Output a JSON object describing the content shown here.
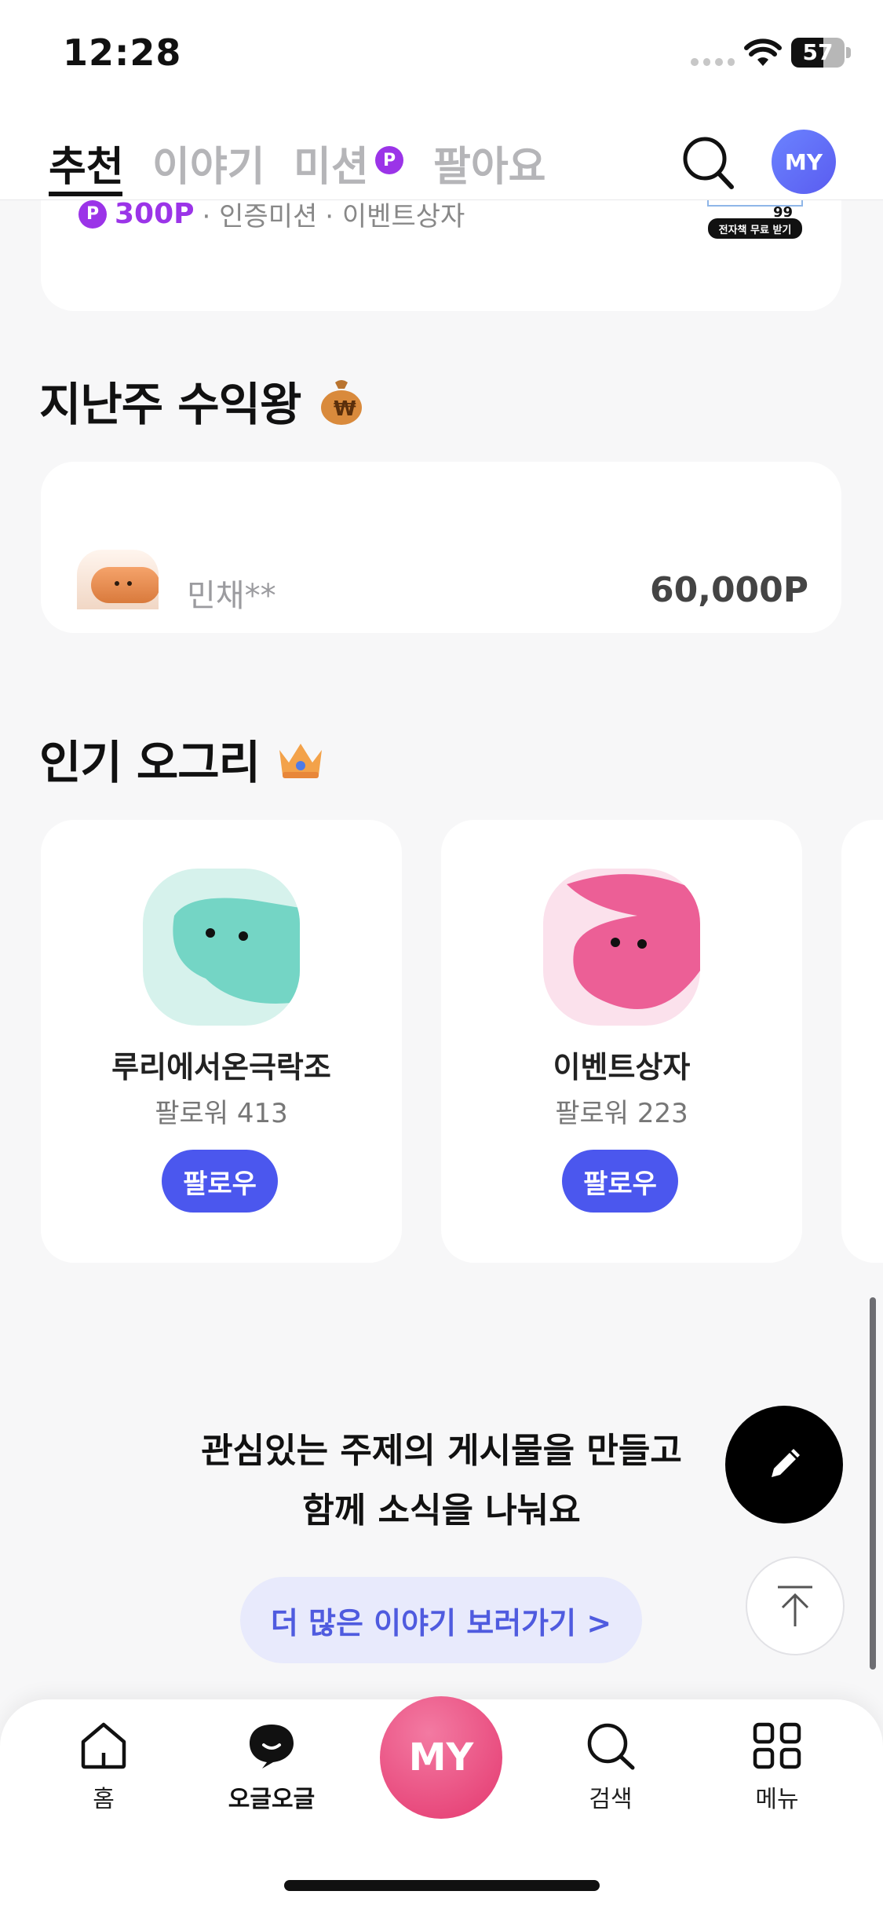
{
  "status_bar": {
    "time": "12:28",
    "battery": "57"
  },
  "top_nav": {
    "tabs": [
      {
        "label": "추천",
        "active": true
      },
      {
        "label": "이야기",
        "active": false
      },
      {
        "label": "미션",
        "active": false,
        "badge": "P"
      },
      {
        "label": "팔아요",
        "active": false
      }
    ],
    "icons": [
      "search-icon"
    ],
    "my_avatar_label": "MY"
  },
  "mission_card": {
    "badge": "P",
    "points": "300P",
    "tags": [
      "· 인증미션",
      "· 이벤트상자"
    ],
    "ebook_button": "전자책 무료 받기"
  },
  "weekly_earner": {
    "title": "지난주 수익왕",
    "icon": "money-bag-icon",
    "entries": [
      {
        "name": "민채**",
        "points": "60,000P"
      }
    ]
  },
  "popular": {
    "title": "인기 오그리",
    "icon": "crown-icon",
    "cards": [
      {
        "name": "루리에서온극락조",
        "followers": "팔로워 413",
        "follow_label": "팔로우",
        "color": "#74d5c5"
      },
      {
        "name": "이벤트상자",
        "followers": "팔로워 223",
        "follow_label": "팔로우",
        "color": "#ec5f96"
      }
    ]
  },
  "promo": {
    "line1": "관심있는 주제의 게시물을 만들고",
    "line2": "함께 소식을 나눠요",
    "button": "더 많은 이야기 보러가기 >"
  },
  "bottom_nav": {
    "items": [
      {
        "label": "홈",
        "icon": "home-icon"
      },
      {
        "label": "오글오글",
        "icon": "chat-bubble-icon"
      },
      {
        "label": "MY",
        "icon": "my-center-button"
      },
      {
        "label": "검색",
        "icon": "search-icon"
      },
      {
        "label": "메뉴",
        "icon": "grid-menu-icon"
      }
    ]
  },
  "colors": {
    "accent": "#4b57ee",
    "point_purple": "#9b34e8",
    "my_pink": "#e4386f"
  }
}
